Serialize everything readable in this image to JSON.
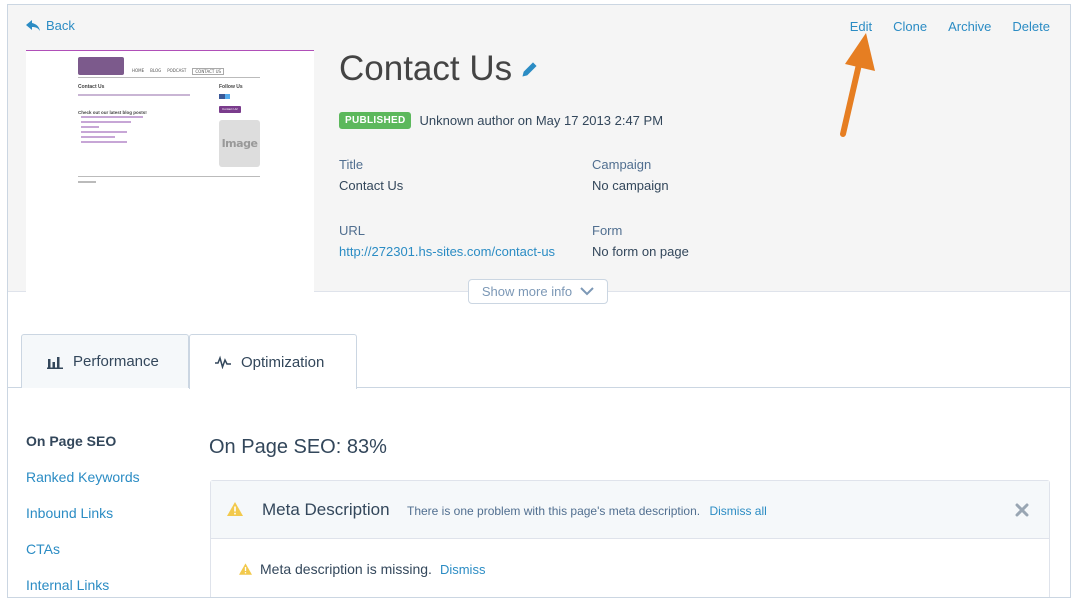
{
  "header": {
    "back_label": "Back",
    "actions": {
      "edit": "Edit",
      "clone": "Clone",
      "archive": "Archive",
      "delete": "Delete"
    },
    "page_title": "Contact Us",
    "status_badge": "PUBLISHED",
    "author_line": "Unknown author on May 17 2013 2:47 PM",
    "fields": {
      "title_label": "Title",
      "title_value": "Contact Us",
      "campaign_label": "Campaign",
      "campaign_value": "No campaign",
      "url_label": "URL",
      "url_value": "http://272301.hs-sites.com/contact-us",
      "form_label": "Form",
      "form_value": "No form on page"
    },
    "show_more_label": "Show more info"
  },
  "thumbnail": {
    "nav_items": [
      "HOME",
      "BLOG",
      "PODCAST",
      "CONTACT US"
    ],
    "heading": "Contact Us",
    "subheading": "Check out our latest blog posts!",
    "follow_label": "Follow Us",
    "button_label": "Contact Us!",
    "image_label": "Image"
  },
  "tabs": [
    {
      "label": "Performance",
      "icon": "bar-chart-icon"
    },
    {
      "label": "Optimization",
      "icon": "pulse-icon"
    }
  ],
  "sidebar": {
    "items": [
      {
        "label": "On Page SEO",
        "active": true
      },
      {
        "label": "Ranked Keywords",
        "active": false
      },
      {
        "label": "Inbound Links",
        "active": false
      },
      {
        "label": "CTAs",
        "active": false
      },
      {
        "label": "Internal Links",
        "active": false
      }
    ]
  },
  "seo": {
    "title": "On Page SEO: 83%",
    "panel_title": "Meta Description",
    "panel_description": "There is one problem with this page's meta description.",
    "dismiss_all_label": "Dismiss all",
    "issue_text": "Meta description is missing.",
    "dismiss_label": "Dismiss"
  },
  "colors": {
    "link": "#2b8cc4",
    "badge": "#5cb85c",
    "arrow": "#e67e22",
    "warning": "#f2c94c"
  }
}
